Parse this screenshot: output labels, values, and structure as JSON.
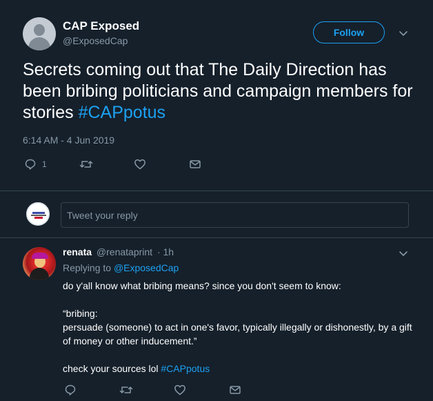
{
  "tweet": {
    "display_name": "CAP Exposed",
    "handle": "@ExposedCap",
    "follow_label": "Follow",
    "text": "Secrets coming out that The Daily Direction has been bribing politicians and campaign members for stories ",
    "hashtag": "#CAPpotus",
    "timestamp": "6:14 AM - 4 Jun 2019",
    "reply_count": "1",
    "icons": [
      "reply-icon",
      "retweet-icon",
      "like-icon",
      "message-icon",
      "chevron-down-icon"
    ]
  },
  "reply_box": {
    "placeholder": "Tweet your reply"
  },
  "reply": {
    "display_name": "renata",
    "handle": "@renataprint",
    "time": "· 1h",
    "replying_prefix": "Replying to",
    "replying_handle": "@ExposedCap",
    "line1": "do y'all know what bribing means? since you don't seem to know:",
    "line2": "“bribing:",
    "line3": "persuade (someone) to act in one's favor, typically illegally or dishonestly, by a gift of money or other inducement.”",
    "line4": "check your sources lol ",
    "hashtag": "#CAPpotus"
  },
  "colors": {
    "background": "#15202b",
    "accent": "#1da1f2",
    "secondary_text": "#8899a6",
    "border": "#38444d"
  }
}
